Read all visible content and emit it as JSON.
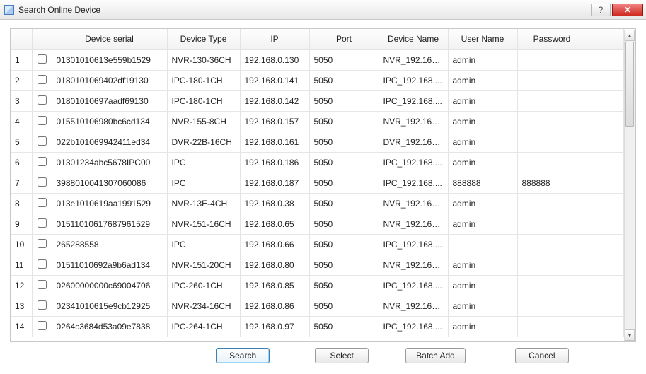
{
  "window": {
    "title": "Search Online Device"
  },
  "table": {
    "headers": {
      "serial": "Device serial",
      "type": "Device Type",
      "ip": "IP",
      "port": "Port",
      "name": "Device Name",
      "user": "User Name",
      "pwd": "Password"
    },
    "rows": [
      {
        "idx": "1",
        "serial": "01301010613e559b1529",
        "type": "NVR-130-36CH",
        "ip": "192.168.0.130",
        "port": "5050",
        "name": "NVR_192.168....",
        "user": "admin",
        "pwd": ""
      },
      {
        "idx": "2",
        "serial": "0180101069402df19130",
        "type": "IPC-180-1CH",
        "ip": "192.168.0.141",
        "port": "5050",
        "name": "IPC_192.168....",
        "user": "admin",
        "pwd": ""
      },
      {
        "idx": "3",
        "serial": "01801010697aadf69130",
        "type": "IPC-180-1CH",
        "ip": "192.168.0.142",
        "port": "5050",
        "name": "IPC_192.168....",
        "user": "admin",
        "pwd": ""
      },
      {
        "idx": "4",
        "serial": "015510106980bc6cd134",
        "type": "NVR-155-8CH",
        "ip": "192.168.0.157",
        "port": "5050",
        "name": "NVR_192.168....",
        "user": "admin",
        "pwd": ""
      },
      {
        "idx": "5",
        "serial": "022b101069942411ed34",
        "type": "DVR-22B-16CH",
        "ip": "192.168.0.161",
        "port": "5050",
        "name": "DVR_192.168....",
        "user": "admin",
        "pwd": ""
      },
      {
        "idx": "6",
        "serial": "01301234abc5678IPC00",
        "type": "IPC",
        "ip": "192.168.0.186",
        "port": "5050",
        "name": "IPC_192.168....",
        "user": "admin",
        "pwd": ""
      },
      {
        "idx": "7",
        "serial": "3988010041307060086",
        "type": "IPC",
        "ip": "192.168.0.187",
        "port": "5050",
        "name": "IPC_192.168....",
        "user": "888888",
        "pwd": "888888"
      },
      {
        "idx": "8",
        "serial": "013e1010619aa1991529",
        "type": "NVR-13E-4CH",
        "ip": "192.168.0.38",
        "port": "5050",
        "name": "NVR_192.168....",
        "user": "admin",
        "pwd": ""
      },
      {
        "idx": "9",
        "serial": "01511010617687961529",
        "type": "NVR-151-16CH",
        "ip": "192.168.0.65",
        "port": "5050",
        "name": "NVR_192.168....",
        "user": "admin",
        "pwd": ""
      },
      {
        "idx": "10",
        "serial": "265288558",
        "type": "IPC",
        "ip": "192.168.0.66",
        "port": "5050",
        "name": "IPC_192.168....",
        "user": "",
        "pwd": ""
      },
      {
        "idx": "11",
        "serial": "01511010692a9b6ad134",
        "type": "NVR-151-20CH",
        "ip": "192.168.0.80",
        "port": "5050",
        "name": "NVR_192.168....",
        "user": "admin",
        "pwd": ""
      },
      {
        "idx": "12",
        "serial": "02600000000c69004706",
        "type": "IPC-260-1CH",
        "ip": "192.168.0.85",
        "port": "5050",
        "name": "IPC_192.168....",
        "user": "admin",
        "pwd": ""
      },
      {
        "idx": "13",
        "serial": "02341010615e9cb12925",
        "type": "NVR-234-16CH",
        "ip": "192.168.0.86",
        "port": "5050",
        "name": "NVR_192.168....",
        "user": "admin",
        "pwd": ""
      },
      {
        "idx": "14",
        "serial": "0264c3684d53a09e7838",
        "type": "IPC-264-1CH",
        "ip": "192.168.0.97",
        "port": "5050",
        "name": "IPC_192.168....",
        "user": "admin",
        "pwd": ""
      }
    ]
  },
  "buttons": {
    "search": "Search",
    "select": "Select",
    "batch": "Batch Add",
    "cancel": "Cancel"
  }
}
